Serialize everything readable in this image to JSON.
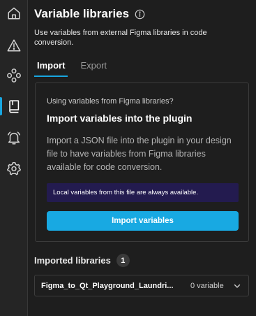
{
  "header": {
    "title": "Variable libraries",
    "subtitle": "Use variables from external Figma libraries in code conversion."
  },
  "sidebar": {
    "items": [
      {
        "icon": "home-icon",
        "active": false
      },
      {
        "icon": "warning-icon",
        "active": false
      },
      {
        "icon": "components-icon",
        "active": false
      },
      {
        "icon": "book-icon",
        "active": true
      },
      {
        "icon": "bell-icon",
        "active": false
      },
      {
        "icon": "gear-icon",
        "active": false
      }
    ]
  },
  "tabs": [
    {
      "label": "Import",
      "active": true
    },
    {
      "label": "Export",
      "active": false
    }
  ],
  "import_card": {
    "eyebrow": "Using variables from Figma libraries?",
    "heading": "Import variables into the plugin",
    "body": "Import a JSON file into the plugin in your design file to have variables from Figma libraries available for code conversion.",
    "notice": "Local variables from this file are always available.",
    "button_label": "Import variables"
  },
  "imported": {
    "title": "Imported libraries",
    "count": "1",
    "libraries": [
      {
        "name": "Figma_to_Qt_Playground_Laundri...",
        "variables": "0 variable"
      }
    ]
  },
  "colors": {
    "accent": "#18a9e2",
    "background": "#1e1e1e",
    "notice_bg": "#231b4f"
  }
}
